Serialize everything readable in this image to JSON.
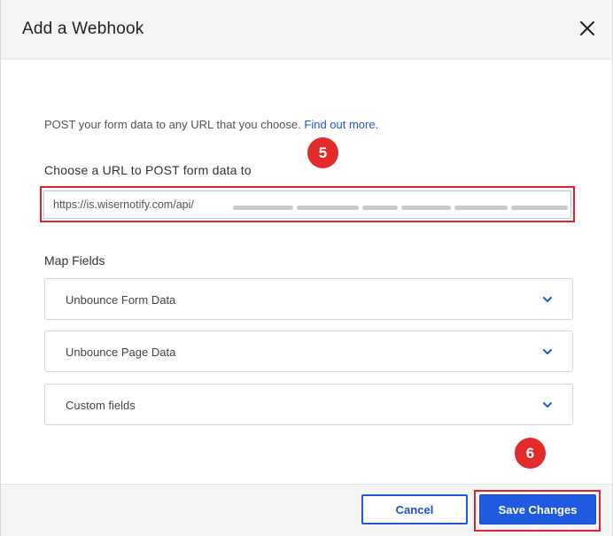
{
  "dialog": {
    "title": "Add a Webhook",
    "close_icon": "close-icon"
  },
  "intro": {
    "text": "POST your form data to any URL that you choose.",
    "link_text": "Find out more."
  },
  "url": {
    "label": "Choose a URL to POST form data to",
    "value_visible": "https://is.wisernotify.com/api/"
  },
  "annotations": {
    "step_url": "5",
    "step_save": "6"
  },
  "map_fields": {
    "label": "Map Fields",
    "sections": [
      {
        "label": "Unbounce Form Data"
      },
      {
        "label": "Unbounce Page Data"
      },
      {
        "label": "Custom fields"
      }
    ]
  },
  "footer": {
    "cancel_label": "Cancel",
    "save_label": "Save Changes"
  },
  "colors": {
    "accent_blue": "#1f5be0",
    "annotation_red": "#e32b2b",
    "header_bg": "#f5f5f5"
  }
}
